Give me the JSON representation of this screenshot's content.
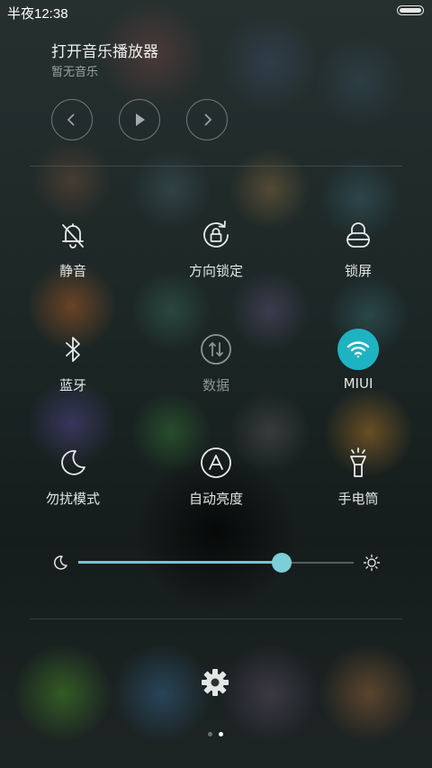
{
  "status_bar": {
    "time": "半夜12:38"
  },
  "music": {
    "title": "打开音乐播放器",
    "subtitle": "暂无音乐"
  },
  "toggles": [
    {
      "label": "静音",
      "icon": "bell-off-icon",
      "active": false
    },
    {
      "label": "方向锁定",
      "icon": "rotation-lock-icon",
      "active": false
    },
    {
      "label": "锁屏",
      "icon": "lock-icon",
      "active": false
    },
    {
      "label": "蓝牙",
      "icon": "bluetooth-icon",
      "active": false
    },
    {
      "label": "数据",
      "icon": "mobile-data-icon",
      "active": false
    },
    {
      "label": "MIUI",
      "icon": "wifi-icon",
      "active": true
    },
    {
      "label": "勿扰模式",
      "icon": "moon-icon",
      "active": false
    },
    {
      "label": "自动亮度",
      "icon": "auto-brightness-icon",
      "active": false
    },
    {
      "label": "手电筒",
      "icon": "flashlight-icon",
      "active": false
    }
  ],
  "brightness": {
    "level": 0.74
  },
  "pager": {
    "pages": 2,
    "current": 2
  },
  "colors": {
    "accent": "#1eb3c2",
    "slider": "#6fc7d0"
  }
}
